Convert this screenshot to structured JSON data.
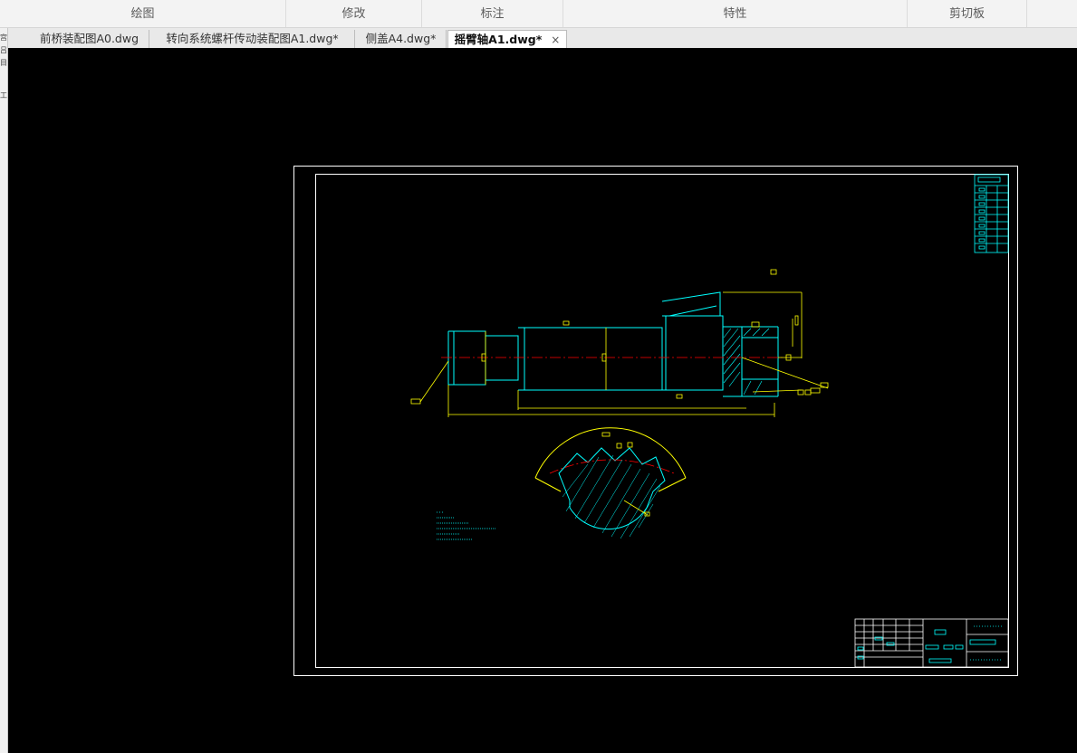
{
  "ribbon": {
    "groups": [
      "绘图",
      "修改",
      "标注",
      "特性",
      "剪切板"
    ]
  },
  "tabs": [
    {
      "label": "前桥装配图A0.dwg",
      "active": false
    },
    {
      "label": "转向系统螺杆传动装配图A1.dwg*",
      "active": false
    },
    {
      "label": "侧盖A4.dwg*",
      "active": false
    },
    {
      "label": "摇臂轴A1.dwg*",
      "active": false,
      "active_tab": true
    }
  ],
  "active_tab_close": "×",
  "left_strip": {
    "glyphs": [
      "宫",
      "吕",
      "目",
      "工"
    ]
  },
  "drawing": {
    "background": "#000000",
    "colors": {
      "frame": "#ffffff",
      "cyan": "#00ffff",
      "yellow": "#ffff00",
      "red": "#ff0000"
    }
  }
}
